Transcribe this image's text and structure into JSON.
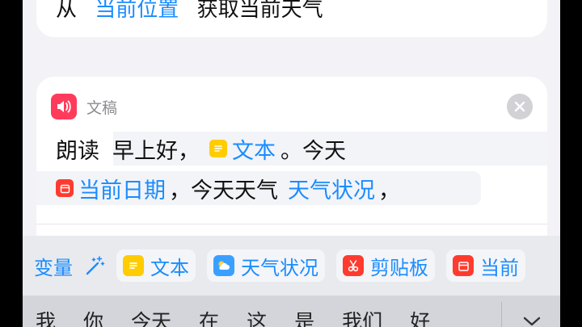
{
  "top_card": {
    "prefix": "从",
    "token": "当前位置",
    "suffix": "获取当前天气"
  },
  "action_card": {
    "title": "文稿",
    "line1": {
      "prefix": "朗读",
      "text1": "早上好，",
      "token": "文本",
      "text2": "。今天"
    },
    "line2": {
      "token1": "当前日期",
      "text1": "，今天天气",
      "token2": "天气状况",
      "text2": "，"
    }
  },
  "variables_bar": {
    "label": "变量",
    "chips": [
      {
        "label": "文本",
        "icon": "text-icon",
        "color": "#ffcc00"
      },
      {
        "label": "天气状况",
        "icon": "weather-icon",
        "color": "#3aa0ff"
      },
      {
        "label": "剪贴板",
        "icon": "scissors-icon",
        "color": "#ff3b30"
      },
      {
        "label": "当前",
        "icon": "calendar-icon",
        "color": "#ff3b30"
      }
    ]
  },
  "keyboard": {
    "candidates": [
      "我",
      "你",
      "今天",
      "在",
      "这",
      "是",
      "我们",
      "好"
    ]
  },
  "colors": {
    "accent": "#1a8cff",
    "background": "#f2f2f7",
    "card": "#ffffff"
  }
}
